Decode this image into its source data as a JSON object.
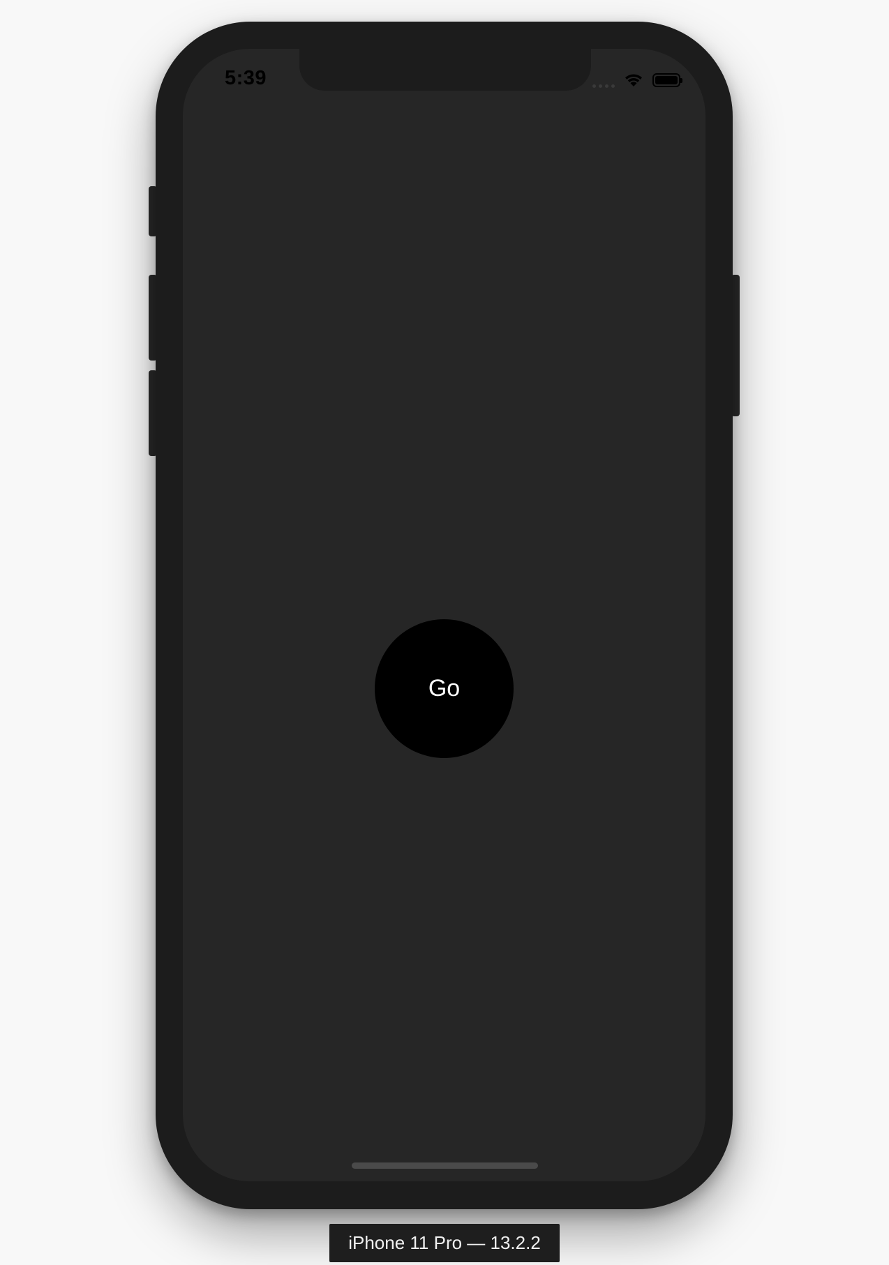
{
  "status_bar": {
    "time": "5:39"
  },
  "main": {
    "go_button_label": "Go"
  },
  "device_label": "iPhone 11 Pro — 13.2.2",
  "colors": {
    "page_background": "#f8f8f8",
    "phone_frame": "#1c1c1c",
    "screen_background": "#262626",
    "button_background": "#000000",
    "button_text": "#ffffff"
  },
  "icons": {
    "signal": "cellular-signal-icon",
    "wifi": "wifi-icon",
    "battery": "battery-icon"
  }
}
